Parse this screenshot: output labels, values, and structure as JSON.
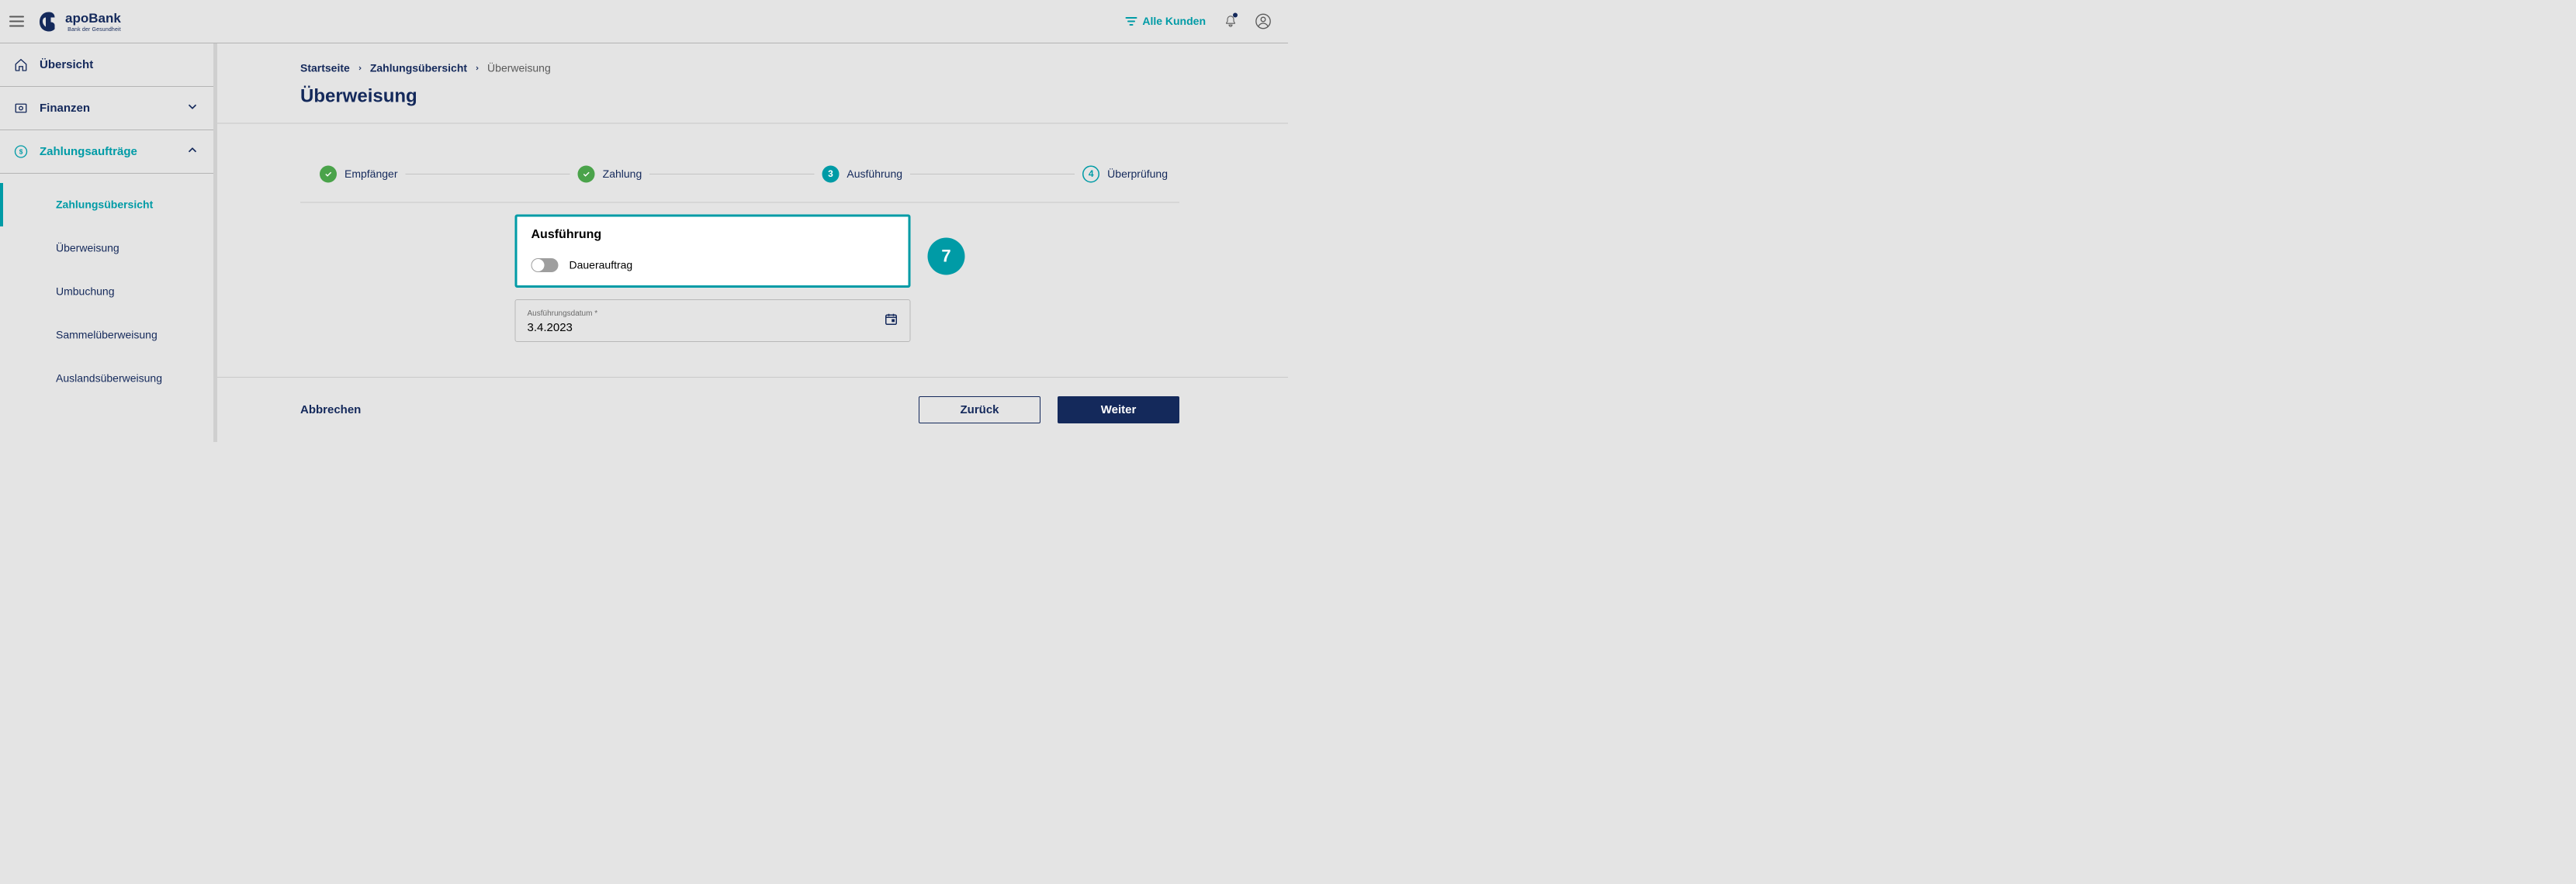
{
  "brand": {
    "name": "apoBank",
    "tagline": "Bank der Gesundheit"
  },
  "header": {
    "customers_label": "Alle Kunden"
  },
  "sidebar": {
    "overview": "Übersicht",
    "finances": "Finanzen",
    "payments": "Zahlungsaufträge",
    "sub": {
      "overview": "Zahlungsübersicht",
      "transfer": "Überweisung",
      "rebook": "Umbuchung",
      "batch": "Sammelüberweisung",
      "foreign": "Auslandsüberweisung"
    }
  },
  "breadcrumb": {
    "home": "Startseite",
    "payments": "Zahlungsübersicht",
    "current": "Überweisung"
  },
  "page": {
    "title": "Überweisung"
  },
  "stepper": {
    "s1": "Empfänger",
    "s2": "Zahlung",
    "s3": "Ausführung",
    "s3_num": "3",
    "s4": "Überprüfung",
    "s4_num": "4"
  },
  "exec": {
    "heading": "Ausführung",
    "toggle_label": "Dauerauftrag",
    "toggle_on": false,
    "date_label": "Ausführungsdatum *",
    "date_value": "3.4.2023"
  },
  "callout": {
    "number": "7"
  },
  "actions": {
    "cancel": "Abbrechen",
    "back": "Zurück",
    "next": "Weiter"
  }
}
